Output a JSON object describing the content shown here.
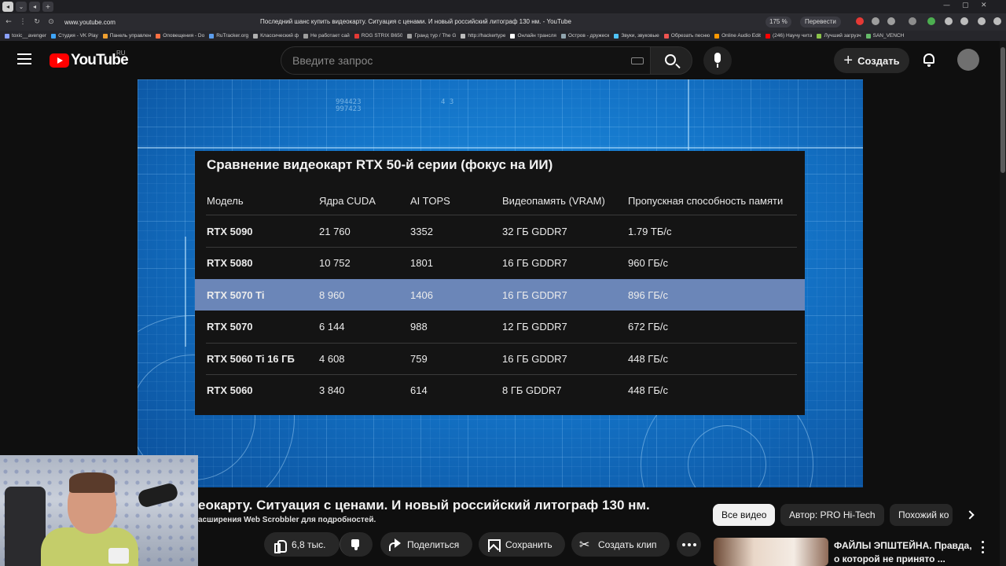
{
  "browser": {
    "url": "www.youtube.com",
    "page_title": "Последний шанс купить видеокарту. Ситуация с ценами. И новый российский литограф 130 нм. - YouTube",
    "zoom": "175 %",
    "translate_label": "Перевести",
    "bookmarks": [
      {
        "label": "toxic__avenger",
        "color": "#8aa0ff"
      },
      {
        "label": "Студия - VK Play",
        "color": "#3ea6ff"
      },
      {
        "label": "Панель управлен",
        "color": "#f0a030"
      },
      {
        "label": "Оповещения - Do",
        "color": "#ff7043"
      },
      {
        "label": "RuTracker.org",
        "color": "#5c9ded"
      },
      {
        "label": "Классический ф",
        "color": "#b0b0b0"
      },
      {
        "label": "Не работает сай",
        "color": "#9e9e9e"
      },
      {
        "label": "ROG STRIX B650",
        "color": "#e53935"
      },
      {
        "label": "Гранд тур / The G",
        "color": "#9e9e9e"
      },
      {
        "label": "http://hackertype",
        "color": "#bdbdbd"
      },
      {
        "label": "Онлайн трансля",
        "color": "#ffffff"
      },
      {
        "label": "Остров - дружеск",
        "color": "#90a4ae"
      },
      {
        "label": "Звуки, звуковые",
        "color": "#4fc3f7"
      },
      {
        "label": "Обрезать песню",
        "color": "#ef5350"
      },
      {
        "label": "Online Audio Edit",
        "color": "#ff9800"
      },
      {
        "label": "(246) Научу чита",
        "color": "#ff0000"
      },
      {
        "label": "Лучший загрузч",
        "color": "#8bc34a"
      },
      {
        "label": "SAN_VENCH",
        "color": "#66bb6a"
      }
    ]
  },
  "header": {
    "logo_text": "YouTube",
    "region": "RU",
    "search_placeholder": "Введите запрос",
    "create_label": "Создать"
  },
  "video": {
    "table": {
      "title": "Сравнение видеокарт RTX 50-й серии (фокус на ИИ)",
      "columns": [
        "Модель",
        "Ядра CUDA",
        "AI TOPS",
        "Видеопамять (VRAM)",
        "Пропускная способность памяти"
      ],
      "rows": [
        [
          "RTX 5090",
          "21 760",
          "3352",
          "32 ГБ GDDR7",
          "1.79 ТБ/с"
        ],
        [
          "RTX 5080",
          "10 752",
          "1801",
          "16 ГБ GDDR7",
          "960 ГБ/с"
        ],
        [
          "RTX 5070 Ti",
          "8 960",
          "1406",
          "16 ГБ GDDR7",
          "896 ГБ/с"
        ],
        [
          "RTX 5070",
          "6 144",
          "988",
          "12 ГБ GDDR7",
          "672 ГБ/с"
        ],
        [
          "RTX 5060 Ti 16 ГБ",
          "4 608",
          "759",
          "16 ГБ GDDR7",
          "448 ГБ/с"
        ],
        [
          "RTX 5060",
          "3 840",
          "614",
          "8 ГБ GDDR7",
          "448 ГБ/с"
        ]
      ],
      "highlight_color": "#6b86b8"
    },
    "bg_digits": [
      "994423",
      "4 3",
      "997423"
    ]
  },
  "below": {
    "title": "еокарту. Ситуация с ценами. И новый российский литограф 130 нм.",
    "subtitle": "асширения Web Scrobbler для подробностей.",
    "chips": [
      "Все видео",
      "Автор: PRO Hi-Tech",
      "Похожий ко"
    ],
    "like_count": "6,8 тыс.",
    "share_label": "Поделиться",
    "save_label": "Сохранить",
    "clip_label": "Создать клип",
    "recommendation_title": "ФАЙЛЫ ЭПШТЕЙНА. Правда, о которой не принято ..."
  }
}
